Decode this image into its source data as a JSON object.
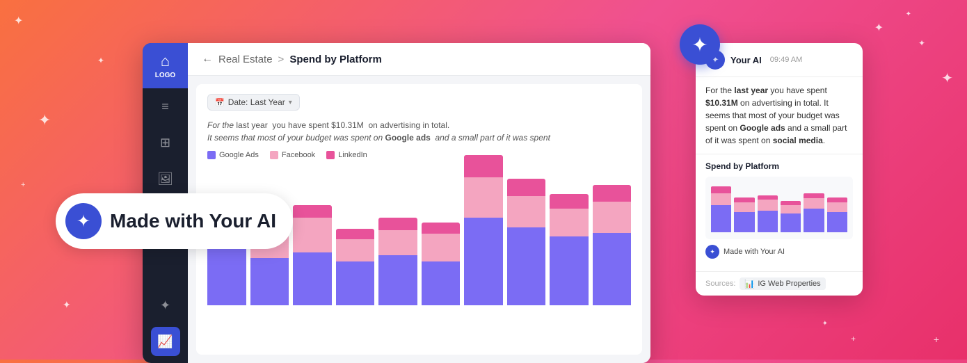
{
  "background": {
    "gradient_start": "#f97040",
    "gradient_end": "#e8306a"
  },
  "sidebar": {
    "logo_text": "LOGO",
    "items": [
      {
        "id": "home",
        "icon": "⌂",
        "active": true
      },
      {
        "id": "document",
        "icon": "📄",
        "active": false
      },
      {
        "id": "grid",
        "icon": "⊞",
        "active": false
      },
      {
        "id": "image",
        "icon": "🖼",
        "active": false
      },
      {
        "id": "star",
        "icon": "✦",
        "active": false
      },
      {
        "id": "chart",
        "icon": "📈",
        "active": true,
        "highlight": true
      }
    ]
  },
  "breadcrumb": {
    "back": "←",
    "parent": "Real Estate",
    "separator": ">",
    "current": "Spend by Platform"
  },
  "filter": {
    "label": "Date: Last Year",
    "icon": "📅"
  },
  "chart_description": {
    "line1": "For the last year  you have spent $10.31M  on advertising in total.",
    "line2": "It seems that most of your budget was spent on Google ads  and a small part of it was spent"
  },
  "legend": [
    {
      "label": "Google Ads",
      "color": "#7b6cf4"
    },
    {
      "label": "Facebook",
      "color": "#f4a5c0"
    },
    {
      "label": "LinkedIn",
      "color": "#e8529a"
    }
  ],
  "bars": [
    {
      "google": 55,
      "facebook": 22,
      "linkedin": 12
    },
    {
      "google": 38,
      "facebook": 20,
      "linkedin": 14
    },
    {
      "google": 42,
      "facebook": 28,
      "linkedin": 10
    },
    {
      "google": 35,
      "facebook": 18,
      "linkedin": 8
    },
    {
      "google": 40,
      "facebook": 20,
      "linkedin": 10
    },
    {
      "google": 35,
      "facebook": 22,
      "linkedin": 9
    },
    {
      "google": 70,
      "facebook": 32,
      "linkedin": 18
    },
    {
      "google": 62,
      "facebook": 25,
      "linkedin": 14
    },
    {
      "google": 55,
      "facebook": 22,
      "linkedin": 12
    },
    {
      "google": 58,
      "facebook": 25,
      "linkedin": 13
    }
  ],
  "ai_badge": {
    "icon": "✦",
    "text": "Made with Your AI"
  },
  "ai_chat": {
    "name": "Your AI",
    "time": "09:49 AM",
    "message_parts": {
      "p1": "For the ",
      "last_year": "last year",
      "p2": " you have spent ",
      "amount": "$10.31M",
      "p3": " on advertising in total.",
      "p4": "It seems that most of your budget was spent on ",
      "google_ads": "Google ads",
      "p5": " and a small part of it was spent on ",
      "social_media": "social media",
      "p6": "."
    },
    "mini_chart_title": "Spend by Platform",
    "made_with": "Made with Your AI",
    "sources_label": "Sources:",
    "sources_value": "IG Web Properties"
  },
  "mini_bars": [
    {
      "google": 40,
      "facebook": 18,
      "linkedin": 10
    },
    {
      "google": 30,
      "facebook": 14,
      "linkedin": 8
    },
    {
      "google": 32,
      "facebook": 16,
      "linkedin": 7
    },
    {
      "google": 28,
      "facebook": 12,
      "linkedin": 6
    },
    {
      "google": 35,
      "facebook": 15,
      "linkedin": 8
    },
    {
      "google": 30,
      "facebook": 14,
      "linkedin": 7
    }
  ]
}
